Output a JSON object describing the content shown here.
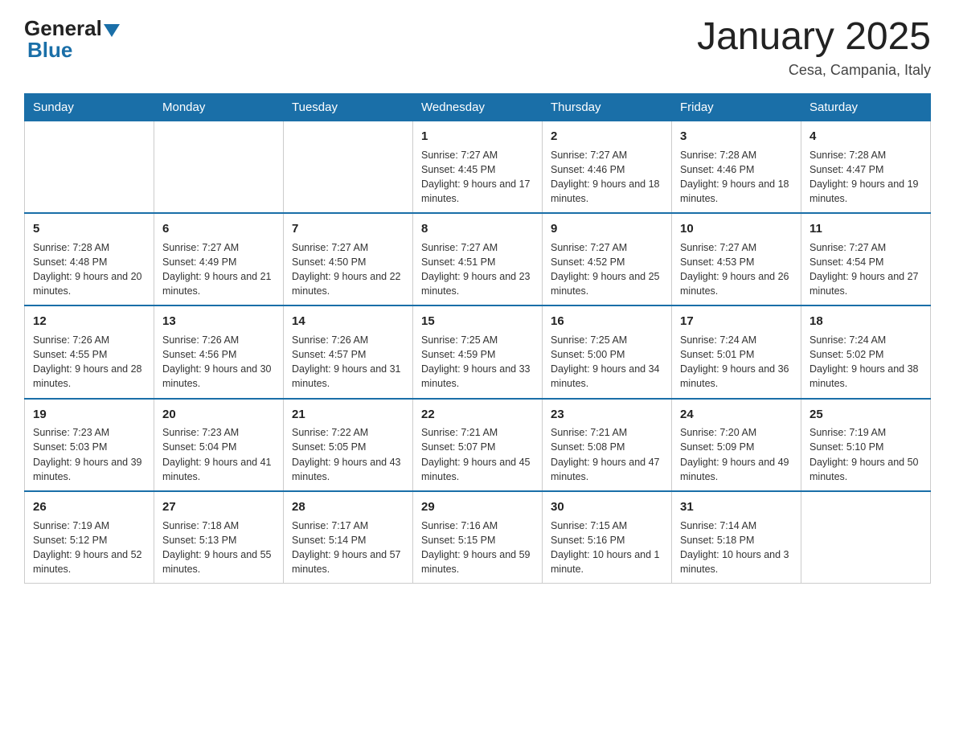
{
  "header": {
    "logo": {
      "general": "General",
      "blue": "Blue"
    },
    "title": "January 2025",
    "subtitle": "Cesa, Campania, Italy"
  },
  "days_of_week": [
    "Sunday",
    "Monday",
    "Tuesday",
    "Wednesday",
    "Thursday",
    "Friday",
    "Saturday"
  ],
  "weeks": [
    [
      {
        "day": "",
        "sunrise": "",
        "sunset": "",
        "daylight": ""
      },
      {
        "day": "",
        "sunrise": "",
        "sunset": "",
        "daylight": ""
      },
      {
        "day": "",
        "sunrise": "",
        "sunset": "",
        "daylight": ""
      },
      {
        "day": "1",
        "sunrise": "Sunrise: 7:27 AM",
        "sunset": "Sunset: 4:45 PM",
        "daylight": "Daylight: 9 hours and 17 minutes."
      },
      {
        "day": "2",
        "sunrise": "Sunrise: 7:27 AM",
        "sunset": "Sunset: 4:46 PM",
        "daylight": "Daylight: 9 hours and 18 minutes."
      },
      {
        "day": "3",
        "sunrise": "Sunrise: 7:28 AM",
        "sunset": "Sunset: 4:46 PM",
        "daylight": "Daylight: 9 hours and 18 minutes."
      },
      {
        "day": "4",
        "sunrise": "Sunrise: 7:28 AM",
        "sunset": "Sunset: 4:47 PM",
        "daylight": "Daylight: 9 hours and 19 minutes."
      }
    ],
    [
      {
        "day": "5",
        "sunrise": "Sunrise: 7:28 AM",
        "sunset": "Sunset: 4:48 PM",
        "daylight": "Daylight: 9 hours and 20 minutes."
      },
      {
        "day": "6",
        "sunrise": "Sunrise: 7:27 AM",
        "sunset": "Sunset: 4:49 PM",
        "daylight": "Daylight: 9 hours and 21 minutes."
      },
      {
        "day": "7",
        "sunrise": "Sunrise: 7:27 AM",
        "sunset": "Sunset: 4:50 PM",
        "daylight": "Daylight: 9 hours and 22 minutes."
      },
      {
        "day": "8",
        "sunrise": "Sunrise: 7:27 AM",
        "sunset": "Sunset: 4:51 PM",
        "daylight": "Daylight: 9 hours and 23 minutes."
      },
      {
        "day": "9",
        "sunrise": "Sunrise: 7:27 AM",
        "sunset": "Sunset: 4:52 PM",
        "daylight": "Daylight: 9 hours and 25 minutes."
      },
      {
        "day": "10",
        "sunrise": "Sunrise: 7:27 AM",
        "sunset": "Sunset: 4:53 PM",
        "daylight": "Daylight: 9 hours and 26 minutes."
      },
      {
        "day": "11",
        "sunrise": "Sunrise: 7:27 AM",
        "sunset": "Sunset: 4:54 PM",
        "daylight": "Daylight: 9 hours and 27 minutes."
      }
    ],
    [
      {
        "day": "12",
        "sunrise": "Sunrise: 7:26 AM",
        "sunset": "Sunset: 4:55 PM",
        "daylight": "Daylight: 9 hours and 28 minutes."
      },
      {
        "day": "13",
        "sunrise": "Sunrise: 7:26 AM",
        "sunset": "Sunset: 4:56 PM",
        "daylight": "Daylight: 9 hours and 30 minutes."
      },
      {
        "day": "14",
        "sunrise": "Sunrise: 7:26 AM",
        "sunset": "Sunset: 4:57 PM",
        "daylight": "Daylight: 9 hours and 31 minutes."
      },
      {
        "day": "15",
        "sunrise": "Sunrise: 7:25 AM",
        "sunset": "Sunset: 4:59 PM",
        "daylight": "Daylight: 9 hours and 33 minutes."
      },
      {
        "day": "16",
        "sunrise": "Sunrise: 7:25 AM",
        "sunset": "Sunset: 5:00 PM",
        "daylight": "Daylight: 9 hours and 34 minutes."
      },
      {
        "day": "17",
        "sunrise": "Sunrise: 7:24 AM",
        "sunset": "Sunset: 5:01 PM",
        "daylight": "Daylight: 9 hours and 36 minutes."
      },
      {
        "day": "18",
        "sunrise": "Sunrise: 7:24 AM",
        "sunset": "Sunset: 5:02 PM",
        "daylight": "Daylight: 9 hours and 38 minutes."
      }
    ],
    [
      {
        "day": "19",
        "sunrise": "Sunrise: 7:23 AM",
        "sunset": "Sunset: 5:03 PM",
        "daylight": "Daylight: 9 hours and 39 minutes."
      },
      {
        "day": "20",
        "sunrise": "Sunrise: 7:23 AM",
        "sunset": "Sunset: 5:04 PM",
        "daylight": "Daylight: 9 hours and 41 minutes."
      },
      {
        "day": "21",
        "sunrise": "Sunrise: 7:22 AM",
        "sunset": "Sunset: 5:05 PM",
        "daylight": "Daylight: 9 hours and 43 minutes."
      },
      {
        "day": "22",
        "sunrise": "Sunrise: 7:21 AM",
        "sunset": "Sunset: 5:07 PM",
        "daylight": "Daylight: 9 hours and 45 minutes."
      },
      {
        "day": "23",
        "sunrise": "Sunrise: 7:21 AM",
        "sunset": "Sunset: 5:08 PM",
        "daylight": "Daylight: 9 hours and 47 minutes."
      },
      {
        "day": "24",
        "sunrise": "Sunrise: 7:20 AM",
        "sunset": "Sunset: 5:09 PM",
        "daylight": "Daylight: 9 hours and 49 minutes."
      },
      {
        "day": "25",
        "sunrise": "Sunrise: 7:19 AM",
        "sunset": "Sunset: 5:10 PM",
        "daylight": "Daylight: 9 hours and 50 minutes."
      }
    ],
    [
      {
        "day": "26",
        "sunrise": "Sunrise: 7:19 AM",
        "sunset": "Sunset: 5:12 PM",
        "daylight": "Daylight: 9 hours and 52 minutes."
      },
      {
        "day": "27",
        "sunrise": "Sunrise: 7:18 AM",
        "sunset": "Sunset: 5:13 PM",
        "daylight": "Daylight: 9 hours and 55 minutes."
      },
      {
        "day": "28",
        "sunrise": "Sunrise: 7:17 AM",
        "sunset": "Sunset: 5:14 PM",
        "daylight": "Daylight: 9 hours and 57 minutes."
      },
      {
        "day": "29",
        "sunrise": "Sunrise: 7:16 AM",
        "sunset": "Sunset: 5:15 PM",
        "daylight": "Daylight: 9 hours and 59 minutes."
      },
      {
        "day": "30",
        "sunrise": "Sunrise: 7:15 AM",
        "sunset": "Sunset: 5:16 PM",
        "daylight": "Daylight: 10 hours and 1 minute."
      },
      {
        "day": "31",
        "sunrise": "Sunrise: 7:14 AM",
        "sunset": "Sunset: 5:18 PM",
        "daylight": "Daylight: 10 hours and 3 minutes."
      },
      {
        "day": "",
        "sunrise": "",
        "sunset": "",
        "daylight": ""
      }
    ]
  ]
}
